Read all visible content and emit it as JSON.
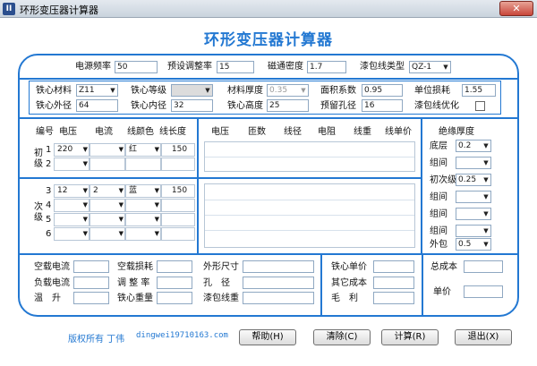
{
  "window": {
    "title": "环形变压器计算器",
    "icon": "II",
    "close": "✕"
  },
  "app_title": "环形变压器计算器",
  "basic": {
    "freq_label": "电源频率",
    "freq": "50",
    "adj_label": "预设调整率",
    "adj": "15",
    "flux_label": "磁通密度",
    "flux": "1.7",
    "wire_type_label": "漆包线类型",
    "wire_type": "QZ-1"
  },
  "core": {
    "material_label": "铁心材料",
    "material": "Z11",
    "grade_label": "铁心等级",
    "grade": "",
    "thick_label": "材料厚度",
    "thick": "0.35",
    "area_coef_label": "面积系数",
    "area_coef": "0.95",
    "unit_loss_label": "单位损耗",
    "unit_loss": "1.55",
    "outer_label": "铁心外径",
    "outer": "64",
    "inner_label": "铁心内径",
    "inner": "32",
    "height_label": "铁心高度",
    "height": "25",
    "hole_label": "预留孔径",
    "hole": "16",
    "opt_label": "漆包线优化"
  },
  "windings": {
    "headers": {
      "no": "编号",
      "voltage": "电压",
      "current": "电流",
      "color": "线颜色",
      "length": "线长度"
    },
    "primary_label": "初级",
    "secondary_label": "次级",
    "primary_rows": [
      {
        "no": "1",
        "voltage": "220",
        "current": "",
        "color": "红",
        "length": "150"
      },
      {
        "no": "2",
        "voltage": "",
        "current": "",
        "color": "",
        "length": ""
      }
    ],
    "secondary_rows": [
      {
        "no": "3",
        "voltage": "12",
        "current": "2",
        "color": "蓝",
        "length": "150"
      },
      {
        "no": "4",
        "voltage": "",
        "current": "",
        "color": "",
        "length": ""
      },
      {
        "no": "5",
        "voltage": "",
        "current": "",
        "color": "",
        "length": ""
      },
      {
        "no": "6",
        "voltage": "",
        "current": "",
        "color": "",
        "length": ""
      }
    ]
  },
  "results": {
    "headers": {
      "voltage": "电压",
      "turns": "匝数",
      "wire": "线径",
      "resistance": "电阻",
      "weight": "线重",
      "unit_price": "线单价"
    }
  },
  "insulation": {
    "title": "绝缘厚度",
    "rows": [
      {
        "label": "底层",
        "value": "0.2"
      },
      {
        "label": "组间",
        "value": ""
      },
      {
        "label": "初次级",
        "value": "0.25"
      },
      {
        "label": "组间",
        "value": ""
      },
      {
        "label": "组间",
        "value": ""
      },
      {
        "label": "组间",
        "value": ""
      },
      {
        "label": "外包",
        "value": "0.5"
      }
    ]
  },
  "summary": {
    "noload_current": "空载电流",
    "noload_loss": "空载损耗",
    "outer_size": "外形尺寸",
    "core_price": "铁心单价",
    "total_cost": "总成本",
    "load_current": "负载电流",
    "regulation": "调 整 率",
    "hole_dia": "孔　径",
    "other_cost": "其它成本",
    "unit_price": "单价",
    "temp_rise": "温　升",
    "core_weight": "铁心重量",
    "wire_weight": "漆包线重",
    "gross_profit": "毛　利"
  },
  "footer": {
    "copyright": "版权所有 丁伟",
    "email": "dingwei19710163.com",
    "help": "帮助(H)",
    "clear": "清除(C)",
    "calc": "计算(R)",
    "exit": "退出(X)"
  },
  "colors": {
    "accent": "#2378d2"
  }
}
